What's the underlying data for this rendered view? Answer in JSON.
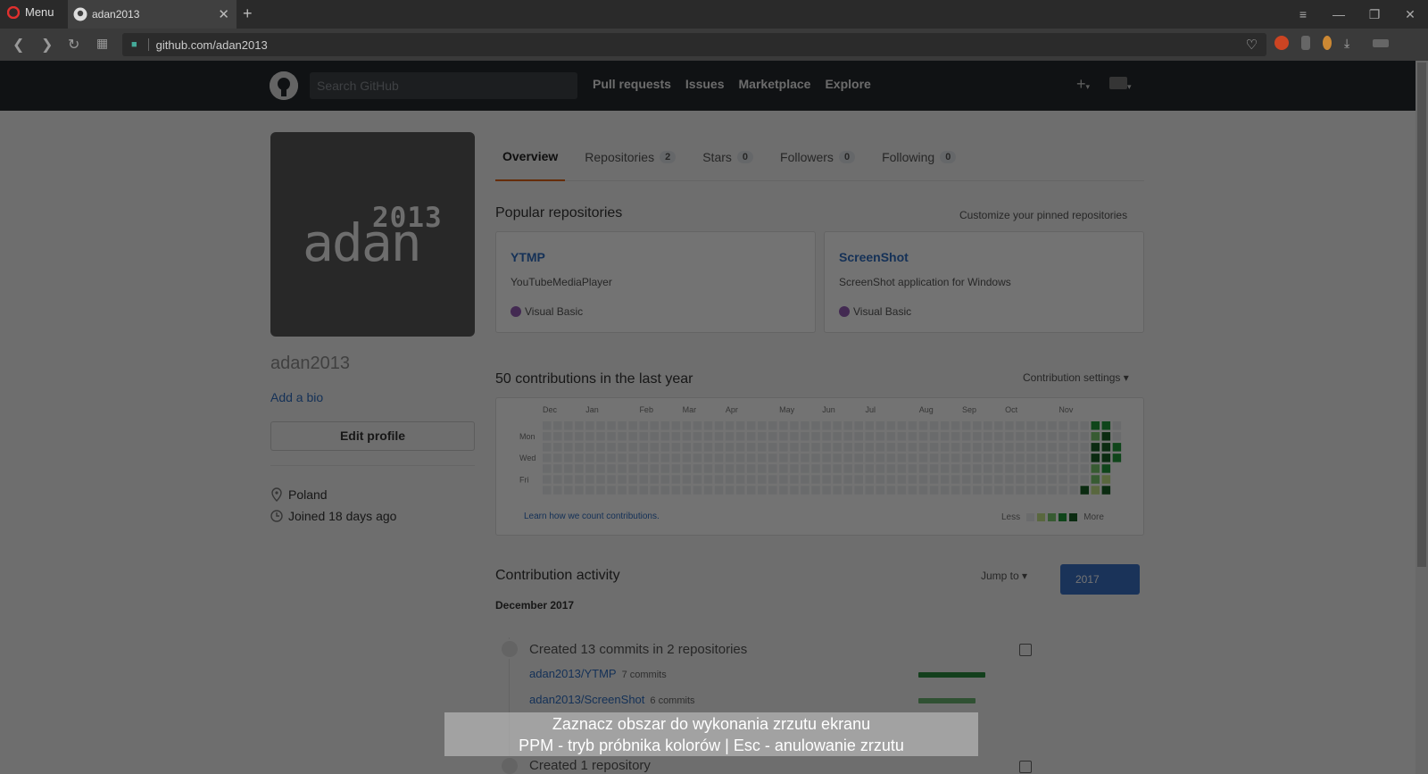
{
  "browser": {
    "menu_label": "Menu",
    "tab_title": "adan2013",
    "url": "github.com/adan2013"
  },
  "gh_header": {
    "search_placeholder": "Search GitHub",
    "nav": [
      "Pull requests",
      "Issues",
      "Marketplace",
      "Explore"
    ]
  },
  "profile": {
    "avatar_year": "2013",
    "avatar_name": "adan",
    "username": "adan2013",
    "add_bio": "Add a bio",
    "edit_profile": "Edit profile",
    "location": "Poland",
    "joined": "Joined 18 days ago"
  },
  "tabs": [
    {
      "label": "Overview",
      "count": null,
      "selected": true
    },
    {
      "label": "Repositories",
      "count": "2"
    },
    {
      "label": "Stars",
      "count": "0"
    },
    {
      "label": "Followers",
      "count": "0"
    },
    {
      "label": "Following",
      "count": "0"
    }
  ],
  "popular": {
    "title": "Popular repositories",
    "customize": "Customize your pinned repositories",
    "repos": [
      {
        "name": "YTMP",
        "desc": "YouTubeMediaPlayer",
        "lang": "Visual Basic"
      },
      {
        "name": "ScreenShot",
        "desc": "ScreenShot application for Windows",
        "lang": "Visual Basic"
      }
    ]
  },
  "contrib": {
    "title": "50 contributions in the last year",
    "settings": "Contribution settings ▾",
    "months": [
      "Dec",
      "Jan",
      "Feb",
      "Mar",
      "Apr",
      "May",
      "Jun",
      "Jul",
      "Aug",
      "Sep",
      "Oct",
      "Nov"
    ],
    "days": [
      "Mon",
      "Wed",
      "Fri"
    ],
    "learn": "Learn how we count contributions.",
    "less": "Less",
    "more": "More",
    "levels": [
      "#ebedf0",
      "#c6e48b",
      "#7bc96f",
      "#239a3b",
      "#196127"
    ],
    "active_cells": [
      {
        "week": 50,
        "day": 6,
        "level": 4
      },
      {
        "week": 51,
        "day": 0,
        "level": 3
      },
      {
        "week": 51,
        "day": 1,
        "level": 2
      },
      {
        "week": 51,
        "day": 2,
        "level": 4
      },
      {
        "week": 51,
        "day": 3,
        "level": 4
      },
      {
        "week": 51,
        "day": 4,
        "level": 2
      },
      {
        "week": 51,
        "day": 5,
        "level": 2
      },
      {
        "week": 51,
        "day": 6,
        "level": 1
      },
      {
        "week": 52,
        "day": 0,
        "level": 3
      },
      {
        "week": 52,
        "day": 1,
        "level": 4
      },
      {
        "week": 52,
        "day": 2,
        "level": 4
      },
      {
        "week": 52,
        "day": 3,
        "level": 4
      },
      {
        "week": 52,
        "day": 4,
        "level": 3
      },
      {
        "week": 52,
        "day": 5,
        "level": 1
      },
      {
        "week": 52,
        "day": 6,
        "level": 4
      },
      {
        "week": 53,
        "day": 2,
        "level": 3
      },
      {
        "week": 53,
        "day": 3,
        "level": 3
      }
    ]
  },
  "activity": {
    "title": "Contribution activity",
    "jump": "Jump to ▾",
    "year": "2017",
    "month": "December 2017",
    "commits_title": "Created 13 commits in 2 repositories",
    "commit_repos": [
      {
        "name": "adan2013/YTMP",
        "count": "7 commits",
        "fraction": 1.0
      },
      {
        "name": "adan2013/ScreenShot",
        "count": "6 commits",
        "fraction": 0.857
      }
    ],
    "created_title": "Created 1 repository"
  },
  "overlay": {
    "line1": "Zaznacz obszar do wykonania zrzutu ekranu",
    "line2": "PPM - tryb próbnika kolorów | Esc - anulowanie zrzutu"
  }
}
